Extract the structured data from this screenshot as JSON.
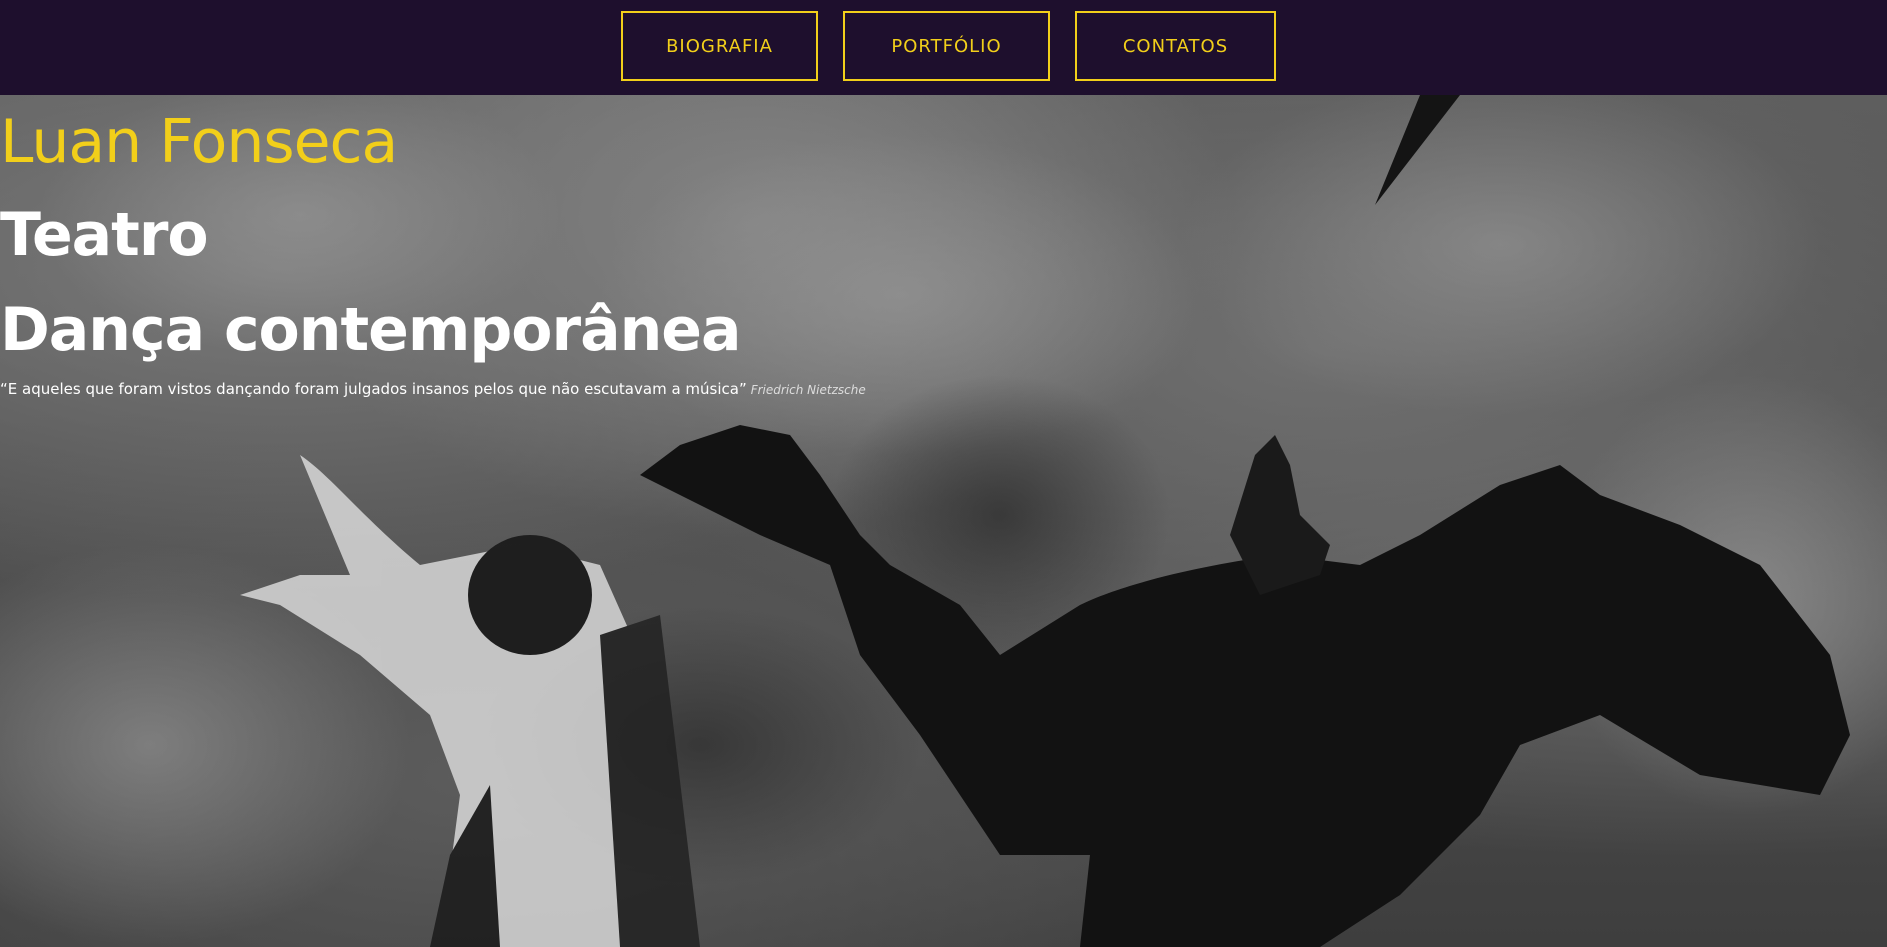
{
  "nav": {
    "items": [
      {
        "label": "BIOGRAFIA"
      },
      {
        "label": "PORTFÓLIO"
      },
      {
        "label": "CONTATOS"
      }
    ]
  },
  "hero": {
    "name": "Luan Fonseca",
    "line1": "Teatro",
    "line2": "Dança contemporânea",
    "quote": "“E aqueles que foram vistos dançando foram julgados insanos pelos que não escutavam a música”",
    "quote_author": "Friedrich Nietzsche"
  },
  "colors": {
    "topbar": "#1e0f2d",
    "accent": "#f2cf1a",
    "text": "#ffffff"
  }
}
